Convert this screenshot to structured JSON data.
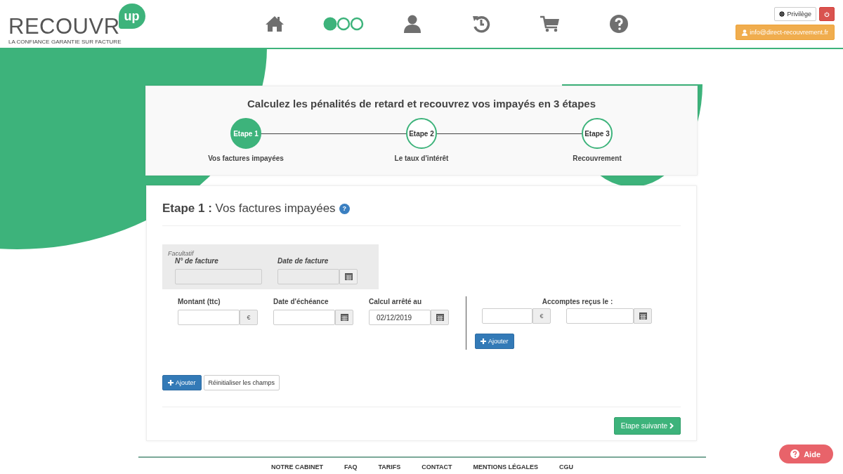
{
  "header": {
    "logo": {
      "wordmark": "RECOUVR",
      "badge": "up",
      "tagline": "LA CONFIANCE GARANTIE SUR FACTURE"
    },
    "nav": [
      {
        "kind": "home",
        "selected": false
      },
      {
        "kind": "steps",
        "selected": true
      },
      {
        "kind": "user",
        "selected": false
      },
      {
        "kind": "history",
        "selected": false
      },
      {
        "kind": "cart",
        "selected": false
      },
      {
        "kind": "help",
        "selected": false
      }
    ],
    "privilege_button": "Privilège",
    "user_email": "info@direct-recouvrement.fr"
  },
  "stepper": {
    "title": "Calculez les pénalités de retard et recouvrez vos impayés en 3 étapes",
    "steps": [
      {
        "label": "Etape 1",
        "caption": "Vos factures impayées",
        "selected": true
      },
      {
        "label": "Etape 2",
        "caption": "Le taux d'intérêt",
        "selected": false
      },
      {
        "label": "Etape 3",
        "caption": "Recouvrement",
        "selected": false
      }
    ]
  },
  "form": {
    "heading_bold": "Etape 1 :",
    "heading": "Vos factures impayées",
    "help_badge": "?",
    "optional": {
      "caption": "Facultatif",
      "fields": [
        {
          "label": "N° de facture",
          "kind": "text"
        },
        {
          "label": "Date de facture",
          "kind": "date"
        }
      ]
    },
    "fields": [
      {
        "label": "Montant (ttc)",
        "kind": "amount",
        "addon": "€"
      },
      {
        "label": "Date d'échéance",
        "kind": "date"
      },
      {
        "label": "Calcul arrêté au",
        "kind": "date",
        "value": "02/12/2019"
      }
    ],
    "deposits": {
      "label": "Accomptes reçus le :",
      "fields": [
        {
          "kind": "amount",
          "addon": "€"
        },
        {
          "kind": "date"
        }
      ],
      "add_button": "Ajouter"
    },
    "add_button": "Ajouter",
    "reset_button": "Réinitialiser les champs",
    "next_button": "Etape suivante"
  },
  "footer": {
    "links": [
      "NOTRE CABINET",
      "FAQ",
      "TARIFS",
      "CONTACT",
      "MENTIONS LÉGALES",
      "CGU"
    ]
  },
  "help_button": "Aide"
}
